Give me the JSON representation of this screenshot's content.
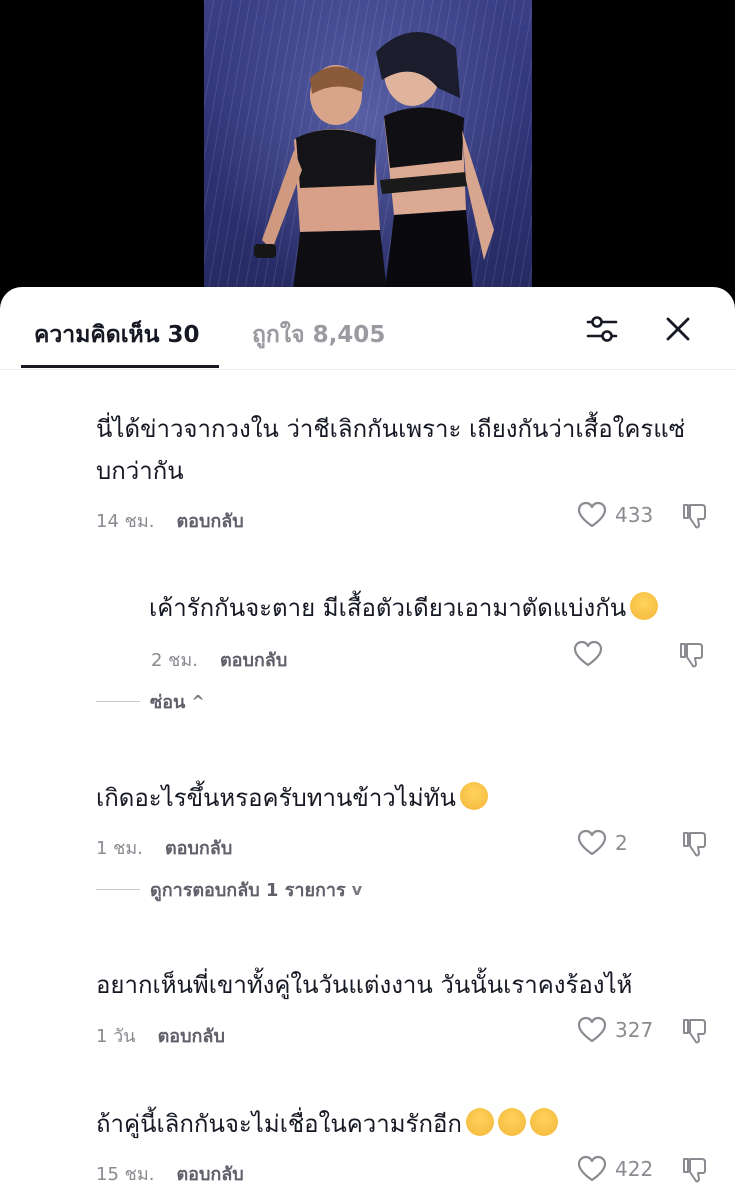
{
  "header": {
    "comments_tab": "ความคิดเห็น 30",
    "likes_tab": "ถูกใจ 8,405",
    "filter_icon": "sliders-icon",
    "close_icon": "close-icon"
  },
  "comments": [
    {
      "text": "นี่ได้ข่าวจากวงใน ว่าชีเลิกกันเพราะ เถียงกันว่าเสื้อใครแซ่บกว่ากัน",
      "time": "14 ชม.",
      "reply_label": "ตอบกลับ",
      "likes": "433"
    },
    {
      "text": "เค้ารักกันจะตาย มีเสื้อตัวเดียวเอามาตัดแบ่งกัน",
      "emoji": "pensive-face",
      "time": "2 ชม.",
      "reply_label": "ตอบกลับ",
      "likes": ""
    },
    {
      "text": "เกิดอะไรขึ้นหรอครับทานข้าวไม่ทัน",
      "emoji": "disappointed-face",
      "time": "1 ชม.",
      "reply_label": "ตอบกลับ",
      "likes": "2"
    },
    {
      "text": "อยากเห็นพี่เขาทั้งคู่ในวันแต่งงาน วันนั้นเราคงร้องไห้",
      "time": "1 วัน",
      "reply_label": "ตอบกลับ",
      "likes": "327"
    },
    {
      "text": "ถ้าคู่นี้เลิกกันจะไม่เชื่อในความรักอีก",
      "emoji": "loudly-crying-face x3",
      "time": "15 ชม.",
      "reply_label": "ตอบกลับ",
      "likes": "422"
    }
  ],
  "threads": {
    "hide_replies": "ซ่อน",
    "view_replies": "ดูการตอบกลับ 1 รายการ"
  }
}
